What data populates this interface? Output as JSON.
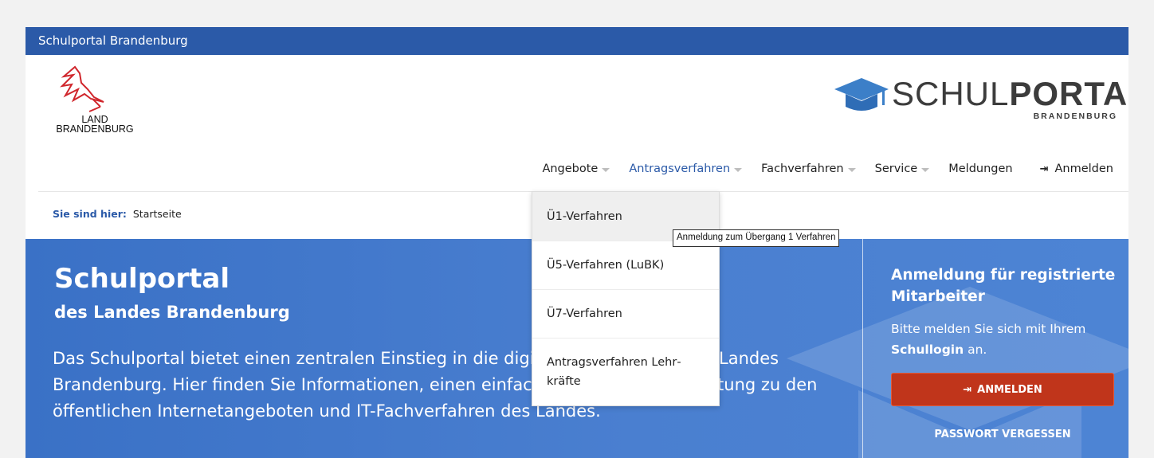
{
  "topbar": {
    "title": "Schulportal Brandenburg"
  },
  "land_logo": {
    "line1": "LAND",
    "line2": "BRANDENBURG"
  },
  "schulportal_logo": {
    "word_light": "SCHUL",
    "word_bold": "PORTAL",
    "sub": "BRANDENBURG",
    "icon": "mortarboard-icon"
  },
  "nav": {
    "items": [
      {
        "label": "Angebote",
        "has_dropdown": true
      },
      {
        "label": "Antragsverfahren",
        "has_dropdown": true,
        "active": true
      },
      {
        "label": "Fachverfahren",
        "has_dropdown": true
      },
      {
        "label": "Service",
        "has_dropdown": true
      },
      {
        "label": "Meldungen"
      }
    ],
    "login_label": "Anmelden",
    "login_icon": "sign-in-icon"
  },
  "breadcrumb": {
    "label": "Sie sind hier:",
    "current": "Startseite"
  },
  "hero": {
    "title": "Schulportal",
    "subtitle": "des Landes Brandenburg",
    "text": "Das Schulportal bietet einen zentralen Einstieg in die digitale Bildungswelt des Landes Brandenburg. Hier finden Sie Informationen, einen einfachen Zugang und Anleitung zu den öffentlichen Internetangeboten und IT-Fachverfahren des Landes."
  },
  "login_box": {
    "title": "Anmeldung für registrierte Mitarbeiter",
    "text_before": "Bitte melden Sie sich mit Ihrem ",
    "text_bold": "Schullogin",
    "text_after": " an.",
    "button": "ANMELDEN",
    "forgot": "PASSWORT VERGESSEN"
  },
  "dropdown": {
    "items": [
      "Ü1-Verfahren",
      "Ü5-Verfahren (LuBK)",
      "Ü7-Verfahren",
      "Antragsverfahren Lehr­kräfte"
    ]
  },
  "tooltip": "Anmeldung zum Übergang 1 Verfahren",
  "colors": {
    "brand_blue": "#2b5aa8",
    "hero_blue": "#4a7fd0",
    "button_red": "#c0351b"
  }
}
